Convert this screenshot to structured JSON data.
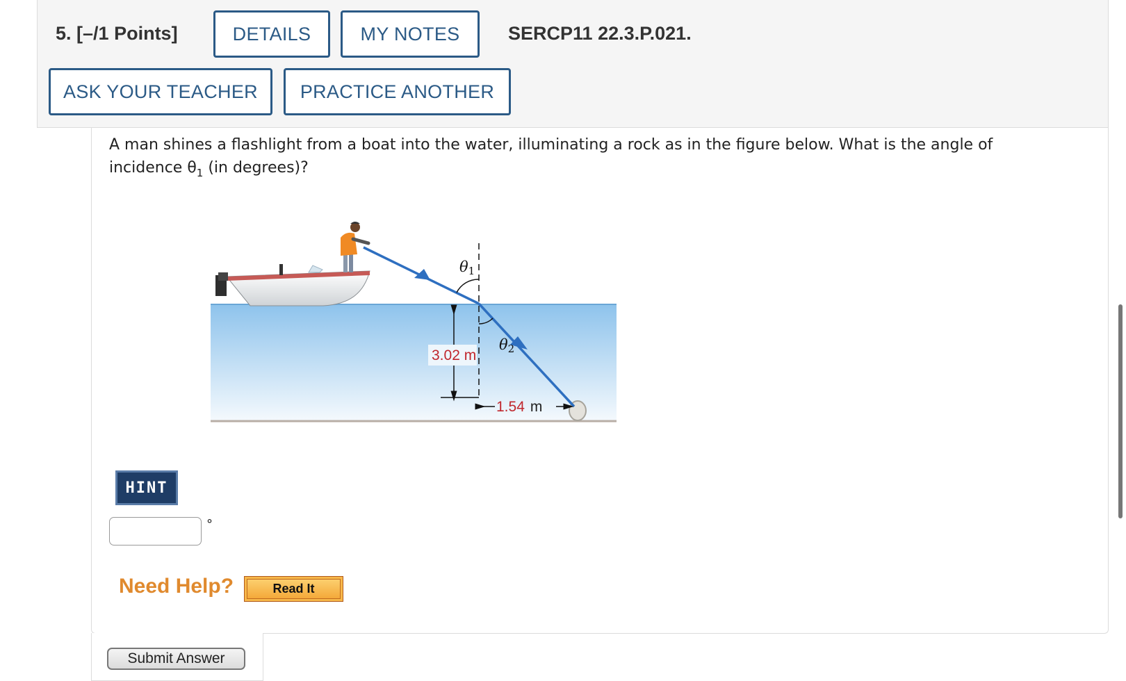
{
  "header": {
    "question_number": "5.",
    "points": "[–/1 Points]",
    "details_label": "DETAILS",
    "my_notes_label": "MY NOTES",
    "problem_code": "SERCP11 22.3.P.021.",
    "ask_teacher_label": "ASK YOUR TEACHER",
    "practice_label": "PRACTICE ANOTHER"
  },
  "question": {
    "text_before": "A man shines a flashlight from a boat into the water, illuminating a rock as in the figure below. What is the angle of incidence θ",
    "subscript": "1",
    "text_after": " (in degrees)?"
  },
  "figure": {
    "theta1_label": "θ",
    "theta1_sub": "1",
    "theta2_label": "θ",
    "theta2_sub": "2",
    "depth_label": "3.02 m",
    "distance_value": "1.54",
    "distance_unit": "m",
    "colors": {
      "ray": "#2e6fc0",
      "measurement": "#c0272d",
      "water_top": "#8ec3ec",
      "water_bottom": "#f4f9fd"
    }
  },
  "hint_label": "HINT",
  "answer": {
    "value": "",
    "unit": "°"
  },
  "help": {
    "need_help_label": "Need Help?",
    "read_it_label": "Read It"
  },
  "submit_label": "Submit Answer"
}
